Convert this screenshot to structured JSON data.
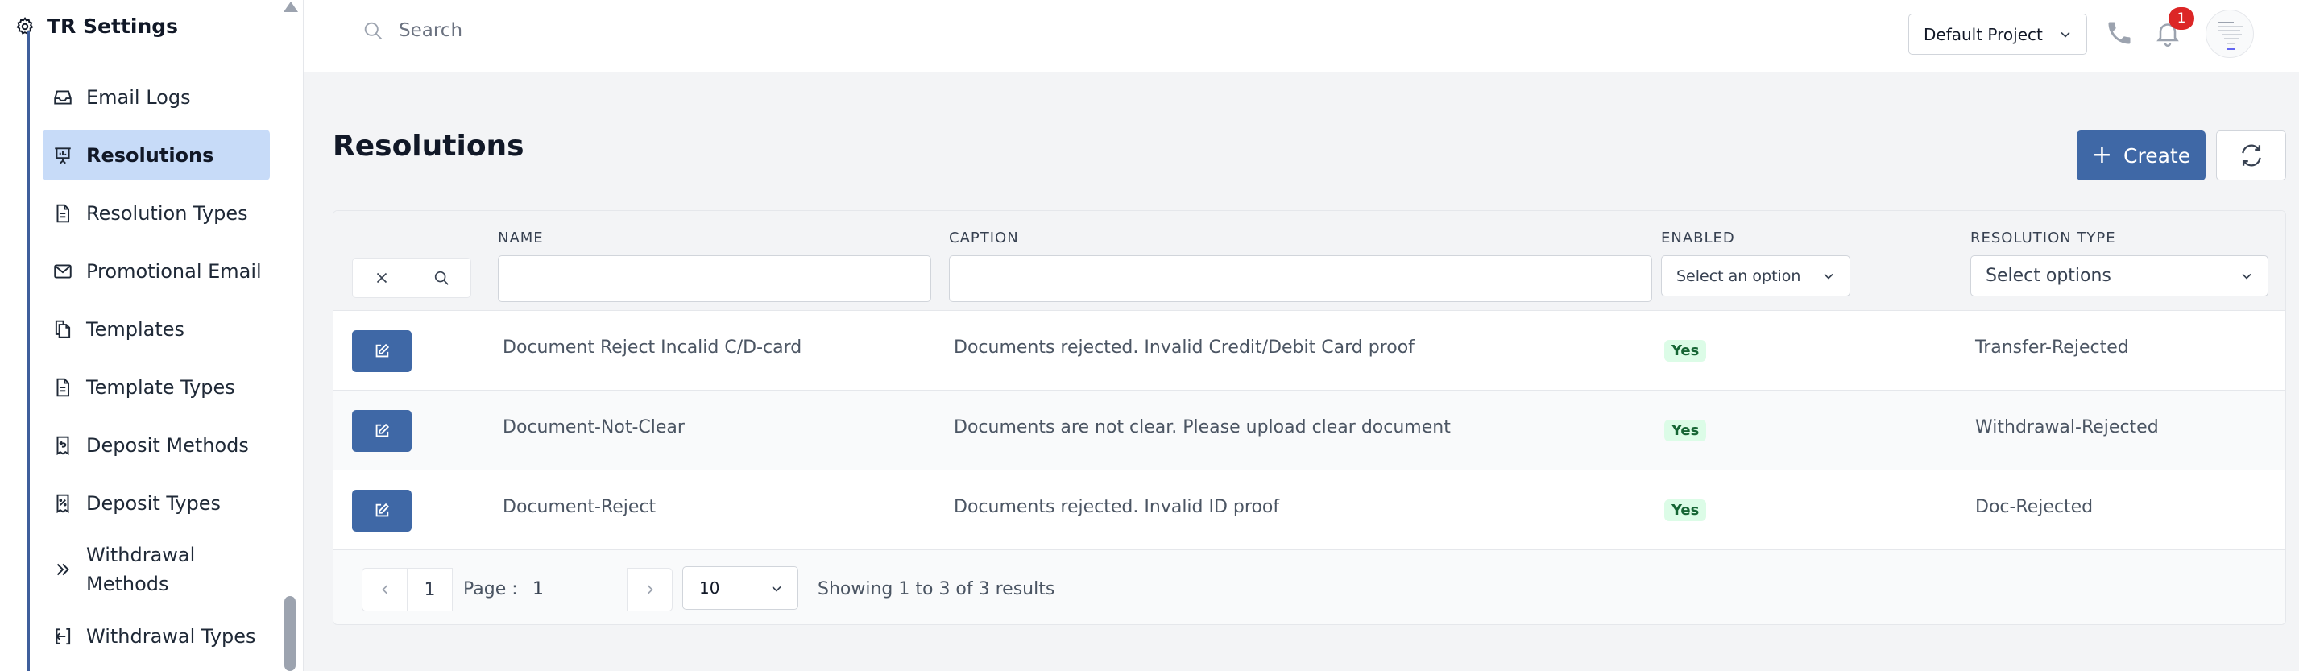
{
  "sidebar": {
    "title": "TR Settings",
    "items": [
      {
        "label": "Email Logs",
        "icon": "inbox-icon"
      },
      {
        "label": "Resolutions",
        "icon": "presentation-icon",
        "active": true
      },
      {
        "label": "Resolution Types",
        "icon": "document-icon"
      },
      {
        "label": "Promotional Email",
        "icon": "envelope-icon"
      },
      {
        "label": "Templates",
        "icon": "copy-icon"
      },
      {
        "label": "Template Types",
        "icon": "document-icon"
      },
      {
        "label": "Deposit Methods",
        "icon": "receipt-refund-icon"
      },
      {
        "label": "Deposit Types",
        "icon": "receipt-tax-icon"
      },
      {
        "label_line1": "Withdrawal",
        "label_line2": "Methods",
        "icon": "chevron-double-right-icon"
      },
      {
        "label": "Withdrawal Types",
        "icon": "logout-icon"
      }
    ]
  },
  "topbar": {
    "search_placeholder": "Search",
    "project": "Default Project",
    "notification_count": "1"
  },
  "page": {
    "title": "Resolutions",
    "create_label": "Create"
  },
  "table": {
    "columns": {
      "name": "NAME",
      "caption": "CAPTION",
      "enabled": "ENABLED",
      "resolution_type": "RESOLUTION TYPE"
    },
    "filters": {
      "enabled_placeholder": "Select an option",
      "type_placeholder": "Select options"
    },
    "rows": [
      {
        "name": "Document Reject Incalid C/D-card",
        "caption": "Documents rejected. Invalid Credit/Debit Card proof",
        "enabled": "Yes",
        "type": "Transfer-Rejected"
      },
      {
        "name": "Document-Not-Clear",
        "caption": "Documents are not clear. Please upload clear document",
        "enabled": "Yes",
        "type": "Withdrawal-Rejected"
      },
      {
        "name": "Document-Reject",
        "caption": "Documents rejected. Invalid ID proof",
        "enabled": "Yes",
        "type": "Doc-Rejected"
      }
    ]
  },
  "pagination": {
    "current_page": "1",
    "page_label": "Page :",
    "page_value": "1",
    "page_size": "10",
    "summary": "Showing 1 to 3 of 3 results"
  },
  "colors": {
    "primary": "#3f68a6",
    "active_bg": "#c7dbf8",
    "badge_red": "#dc2626",
    "yes_bg": "#dcfce7",
    "yes_text": "#166534"
  }
}
